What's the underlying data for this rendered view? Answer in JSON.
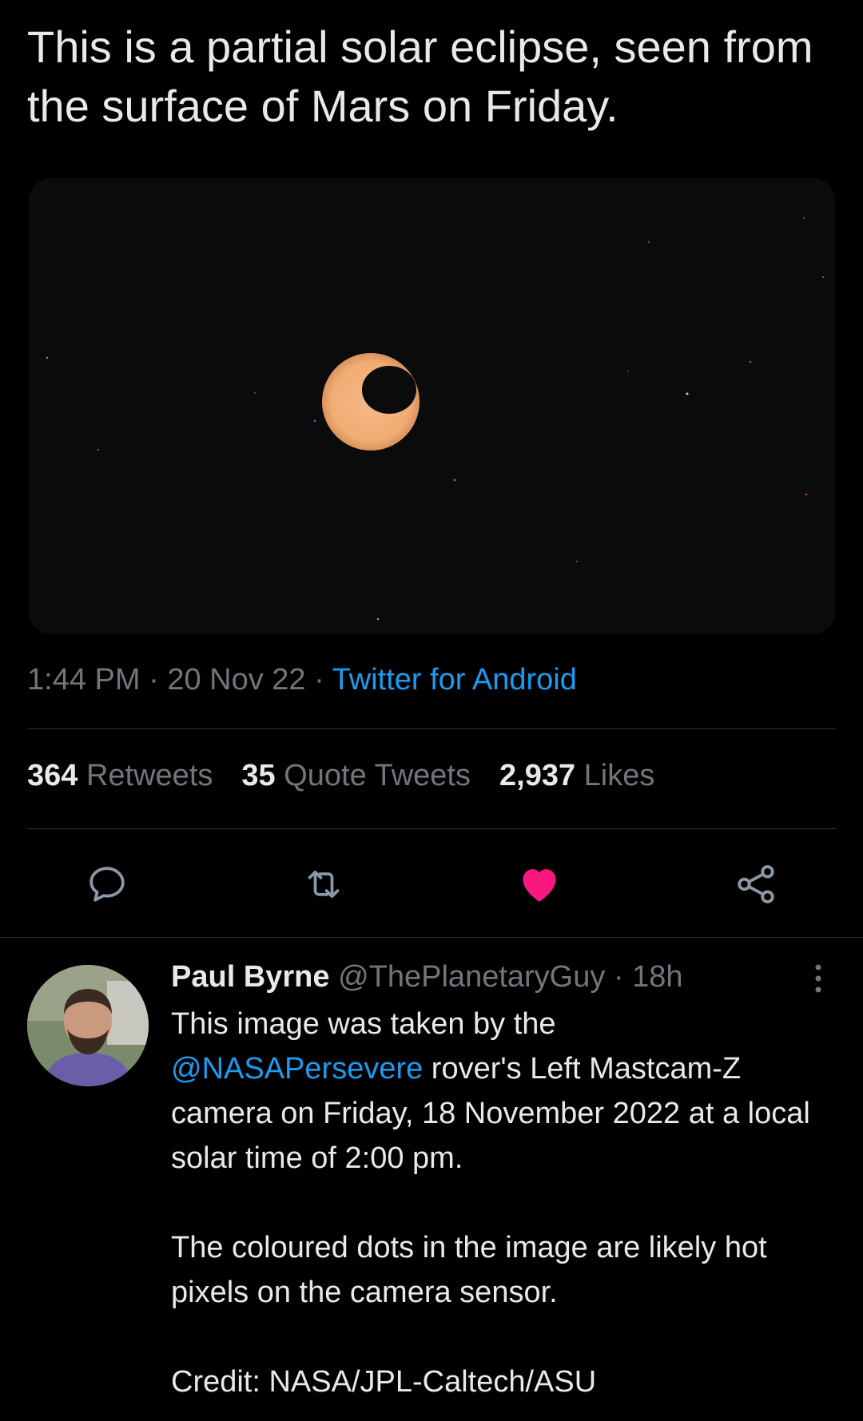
{
  "tweet": {
    "text": "This is a partial solar eclipse, seen from the surface of Mars on Friday.",
    "time": "1:44 PM",
    "date": "20 Nov 22",
    "separator": "·",
    "source": "Twitter for Android"
  },
  "stats": {
    "retweets_count": "364",
    "retweets_label": "Retweets",
    "quotes_count": "35",
    "quotes_label": "Quote Tweets",
    "likes_count": "2,937",
    "likes_label": "Likes"
  },
  "actions": {
    "reply_icon": "reply-bubble-icon",
    "retweet_icon": "retweet-icon",
    "like_icon": "heart-filled-icon",
    "share_icon": "share-icon",
    "like_color": "#f91880"
  },
  "reply": {
    "name": "Paul Byrne",
    "handle": "@ThePlanetaryGuy",
    "separator": "·",
    "age": "18h",
    "line1_pre": "This image was taken by the",
    "mention": "@NASAPersevere",
    "line1_post": " rover's Left Mastcam-Z camera on Friday, 18 November 2022 at a local solar time of 2:00 pm.",
    "para2": "The coloured dots in the image are likely hot pixels on the camera sensor.",
    "para3": "Credit: NASA/JPL-Caltech/ASU"
  },
  "colors": {
    "background": "#000000",
    "text": "#e7e9ea",
    "muted": "#71767b",
    "link": "#1d9bf0",
    "sun": "#f2b07a"
  }
}
